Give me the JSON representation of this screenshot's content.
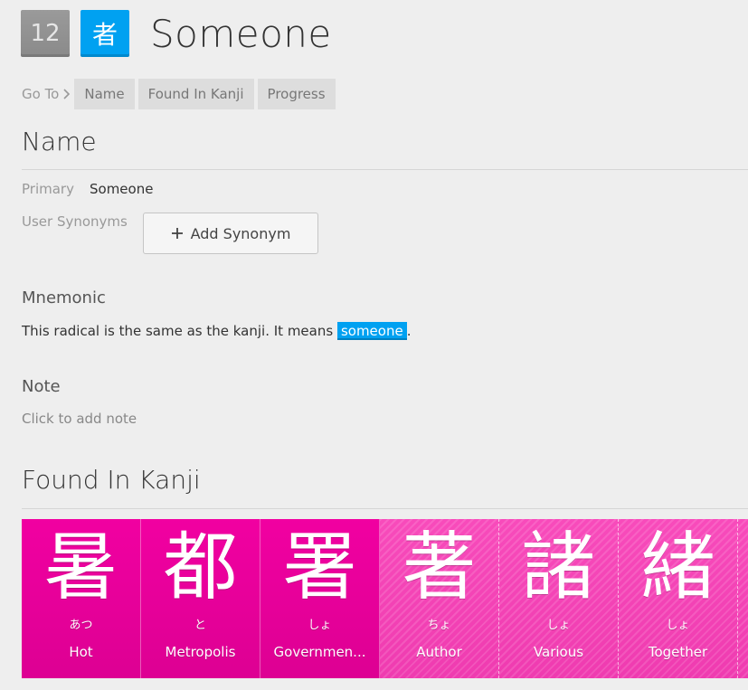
{
  "header": {
    "level": "12",
    "radical_character": "者",
    "title": "Someone"
  },
  "goto": {
    "label": "Go To",
    "links": [
      "Name",
      "Found In Kanji",
      "Progress"
    ]
  },
  "name_section": {
    "title": "Name",
    "primary_label": "Primary",
    "primary_value": "Someone",
    "synonyms_label": "User Synonyms",
    "add_synonym_label": "Add Synonym"
  },
  "mnemonic": {
    "title": "Mnemonic",
    "text_before": "This radical is the same as the kanji. It means ",
    "highlight": "someone",
    "text_after": "."
  },
  "note": {
    "title": "Note",
    "placeholder": "Click to add note"
  },
  "found_in_kanji": {
    "title": "Found In Kanji",
    "items": [
      {
        "character": "暑",
        "reading": "あつ",
        "meaning": "Hot",
        "style": "solid"
      },
      {
        "character": "都",
        "reading": "と",
        "meaning": "Metropolis",
        "style": "solid"
      },
      {
        "character": "署",
        "reading": "しょ",
        "meaning": "Governmen...",
        "style": "solid"
      },
      {
        "character": "著",
        "reading": "ちょ",
        "meaning": "Author",
        "style": "striped"
      },
      {
        "character": "諸",
        "reading": "しょ",
        "meaning": "Various",
        "style": "striped"
      },
      {
        "character": "緒",
        "reading": "しょ",
        "meaning": "Together",
        "style": "striped"
      }
    ]
  },
  "colors": {
    "radical_blue": "#00a1f1",
    "kanji_pink": "#f100a1",
    "level_gray": "#8f8f8f"
  },
  "icons": {
    "goto_chevron": "chevron-right-icon",
    "add": "plus-icon"
  }
}
